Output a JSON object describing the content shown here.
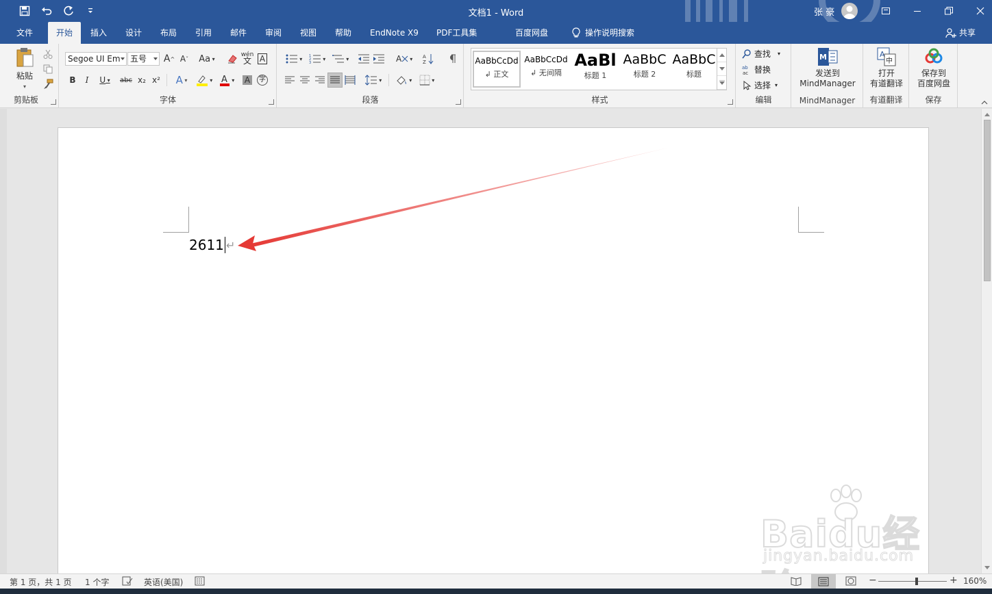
{
  "window": {
    "title": "文档1 - Word",
    "user_name": "张 豪"
  },
  "tabs": [
    {
      "label": "文件"
    },
    {
      "label": "开始"
    },
    {
      "label": "插入"
    },
    {
      "label": "设计"
    },
    {
      "label": "布局"
    },
    {
      "label": "引用"
    },
    {
      "label": "邮件"
    },
    {
      "label": "审阅"
    },
    {
      "label": "视图"
    },
    {
      "label": "帮助"
    },
    {
      "label": "EndNote X9"
    },
    {
      "label": "PDF工具集"
    },
    {
      "label": "百度网盘"
    },
    {
      "label": "操作说明搜索"
    }
  ],
  "share_label": "共享",
  "ribbon": {
    "clipboard": {
      "label": "剪贴板",
      "paste_label": "粘贴"
    },
    "font": {
      "label": "字体",
      "font_name": "Segoe UI Em",
      "font_size": "五号",
      "bold": "B",
      "italic": "I",
      "underline": "U",
      "strike": "abc",
      "subscript": "x₂",
      "superscript": "x²",
      "case": "Aa",
      "char_border": "A",
      "char_shading": "A",
      "enclose": "字"
    },
    "paragraph": {
      "label": "段落"
    },
    "styles": {
      "label": "样式",
      "items": [
        {
          "sample": "AaBbCcDd",
          "name": "↲ 正文"
        },
        {
          "sample": "AaBbCcDd",
          "name": "↲ 无间隔"
        },
        {
          "sample": "AaBl",
          "name": "标题 1"
        },
        {
          "sample": "AaBbC",
          "name": "标题 2"
        },
        {
          "sample": "AaBbC",
          "name": "标题"
        }
      ]
    },
    "editing": {
      "label": "编辑",
      "find": "查找",
      "replace": "替换",
      "select": "选择"
    },
    "mindmanager": {
      "button": "发送到 MindManager",
      "label": "MindManager"
    },
    "youdao": {
      "button_line1": "打开",
      "button_line2": "有道翻译",
      "label": "有道翻译"
    },
    "save": {
      "button_line1": "保存到",
      "button_line2": "百度网盘",
      "label": "保存"
    }
  },
  "document": {
    "text": "2611"
  },
  "statusbar": {
    "page": "第 1 页，共 1 页",
    "words": "1 个字",
    "language": "英语(美国)",
    "zoom": "160%",
    "zoom_fraction": 0.56
  },
  "watermark": {
    "logo_text": "Baidu经验",
    "url": "jingyan.baidu.com"
  },
  "colors": {
    "brand": "#2b579a",
    "arrow": "#e53935"
  }
}
